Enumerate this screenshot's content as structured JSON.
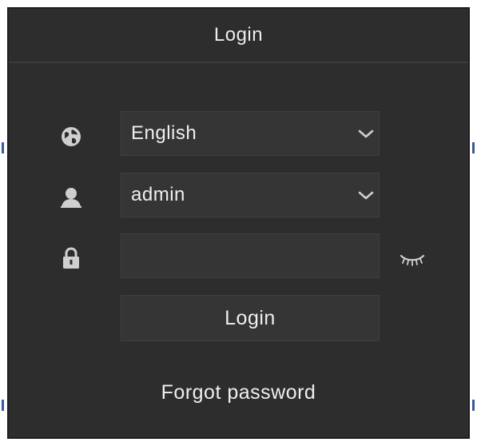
{
  "dialog": {
    "title": "Login"
  },
  "form": {
    "language": {
      "icon": "globe-icon",
      "selected": "English"
    },
    "username": {
      "icon": "user-icon",
      "selected": "admin"
    },
    "password": {
      "icon": "lock-icon",
      "value": "",
      "toggle_icon": "eye-closed-icon"
    },
    "login_label": "Login",
    "forgot_label": "Forgot password"
  },
  "colors": {
    "panel_bg": "#2d2d2d",
    "field_bg": "#353535",
    "text": "#efefef",
    "icon": "#cfcfcf",
    "edge_accent": "#3a5aa0"
  }
}
